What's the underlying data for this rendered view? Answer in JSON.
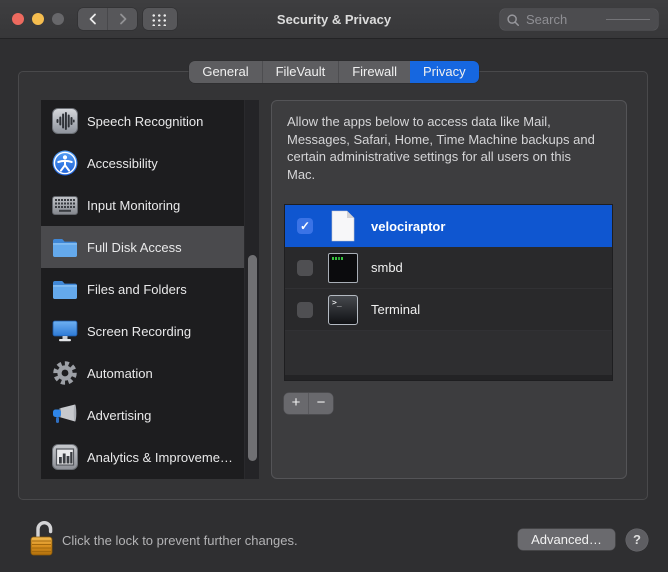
{
  "titlebar": {
    "title": "Security & Privacy",
    "search_placeholder": "Search"
  },
  "tabs": [
    {
      "label": "General",
      "selected": false
    },
    {
      "label": "FileVault",
      "selected": false
    },
    {
      "label": "Firewall",
      "selected": false
    },
    {
      "label": "Privacy",
      "selected": true
    }
  ],
  "sidebar": {
    "items": [
      {
        "label": "Speech Recognition",
        "icon": "waveform-icon",
        "selected": false
      },
      {
        "label": "Accessibility",
        "icon": "accessibility-icon",
        "selected": false
      },
      {
        "label": "Input Monitoring",
        "icon": "keyboard-icon",
        "selected": false
      },
      {
        "label": "Full Disk Access",
        "icon": "folder-icon",
        "selected": true
      },
      {
        "label": "Files and Folders",
        "icon": "folder-icon",
        "selected": false
      },
      {
        "label": "Screen Recording",
        "icon": "display-icon",
        "selected": false
      },
      {
        "label": "Automation",
        "icon": "gear-icon",
        "selected": false
      },
      {
        "label": "Advertising",
        "icon": "megaphone-icon",
        "selected": false
      },
      {
        "label": "Analytics & Improveme…",
        "icon": "bar-chart-icon",
        "selected": false
      }
    ]
  },
  "privacy": {
    "description": "Allow the apps below to access data like Mail, Messages, Safari, Home, Time Machine backups and certain administrative settings for all users on this Mac.",
    "apps": [
      {
        "name": "velociraptor",
        "checked": true,
        "selected": true,
        "icon": "document-icon"
      },
      {
        "name": "smbd",
        "checked": false,
        "selected": false,
        "icon": "terminal-app-icon"
      },
      {
        "name": "Terminal",
        "checked": false,
        "selected": false,
        "icon": "terminal-app-icon"
      }
    ]
  },
  "list_buttons": {
    "add": "+",
    "remove": "−"
  },
  "footer": {
    "lock_message": "Click the lock to prevent further changes.",
    "advanced_label": "Advanced…",
    "help_label": "?"
  },
  "icons": {
    "check": "✓",
    "terminal_prompt": ">_"
  },
  "colors": {
    "accent_blue": "#1667e0",
    "selection_blue": "#0f56d0",
    "titlebar": "#3a3a3c"
  }
}
